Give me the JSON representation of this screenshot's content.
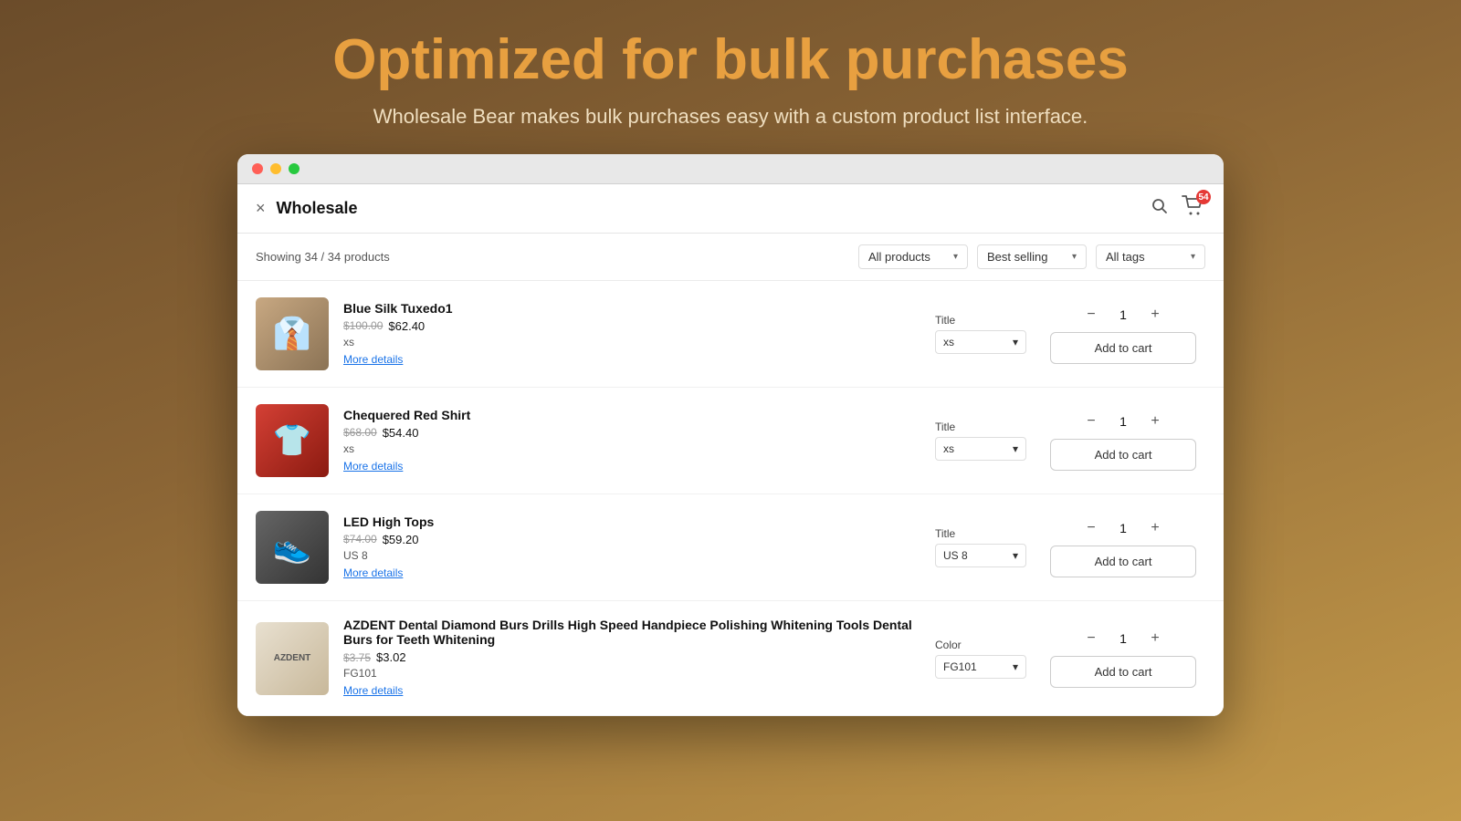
{
  "page": {
    "hero": {
      "title_white": "Optimized for",
      "title_orange": "bulk purchases",
      "subtitle": "Wholesale Bear makes bulk purchases easy with a custom product list interface."
    },
    "browser": {
      "dots": [
        "red",
        "yellow",
        "green"
      ]
    },
    "app": {
      "close_label": "×",
      "title": "Wholesale",
      "search_icon": "🔍",
      "cart_icon": "🛒",
      "cart_count": "54"
    },
    "filters": {
      "showing_text": "Showing 34 / 34 products",
      "all_products_label": "All products",
      "best_selling_label": "Best selling",
      "all_tags_label": "All tags"
    },
    "products": [
      {
        "id": "p1",
        "name": "Blue Silk Tuxedo1",
        "price_original": "$100.00",
        "price_sale": "$62.40",
        "variant": "xs",
        "more_details": "More details",
        "selector_label": "Title",
        "selector_value": "xs",
        "qty": "1",
        "add_to_cart": "Add to cart",
        "img_type": "tuxedo",
        "img_icon": "👔"
      },
      {
        "id": "p2",
        "name": "Chequered Red Shirt",
        "price_original": "$68.00",
        "price_sale": "$54.40",
        "variant": "xs",
        "more_details": "More details",
        "selector_label": "Title",
        "selector_value": "xs",
        "qty": "1",
        "add_to_cart": "Add to cart",
        "img_type": "shirt",
        "img_icon": "👕"
      },
      {
        "id": "p3",
        "name": "LED High Tops",
        "price_original": "$74.00",
        "price_sale": "$59.20",
        "variant": "US 8",
        "more_details": "More details",
        "selector_label": "Title",
        "selector_value": "US 8",
        "qty": "1",
        "add_to_cart": "Add to cart",
        "img_type": "shoes",
        "img_icon": "👟"
      },
      {
        "id": "p4",
        "name": "AZDENT Dental Diamond Burs Drills High Speed Handpiece Polishing Whitening Tools Dental Burs for Teeth Whitening",
        "price_original": "$3.75",
        "price_sale": "$3.02",
        "variant": "FG101",
        "more_details": "More details",
        "selector_label": "Color",
        "selector_value": "FG101",
        "qty": "1",
        "add_to_cart": "Add to cart",
        "img_type": "dental",
        "img_icon": "AZDENT"
      }
    ]
  }
}
